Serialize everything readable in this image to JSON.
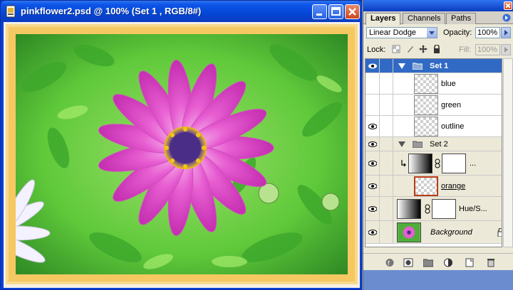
{
  "document": {
    "title": "pinkflower2.psd @ 100% (Set 1 , RGB/8#)",
    "icons": {
      "app": "photoshop-doc-icon",
      "minimize": "minimize-icon",
      "maximize": "maximize-icon",
      "close": "close-icon"
    }
  },
  "colors": {
    "frame_outer": "#f5c861",
    "frame_inner": "#f9d98b",
    "selection": "#316ac5",
    "title_blue": "#0446d6"
  },
  "layers_panel": {
    "tabs": [
      "Layers",
      "Channels",
      "Paths"
    ],
    "active_tab": "Layers",
    "blend_mode": "Linear Dodge",
    "opacity_label": "Opacity:",
    "opacity_value": "100%",
    "lock_label": "Lock:",
    "fill_label": "Fill:",
    "fill_value": "100%",
    "layers": [
      {
        "name": "Set 1",
        "type": "group",
        "expanded": true,
        "selected": true,
        "visible": true
      },
      {
        "name": "blue",
        "type": "layer",
        "visible": false
      },
      {
        "name": "green",
        "type": "layer",
        "visible": false
      },
      {
        "name": "outline",
        "type": "layer",
        "visible": true
      },
      {
        "name": "Set 2",
        "type": "group",
        "expanded": true,
        "visible": true
      },
      {
        "name": "...",
        "type": "adjustment-clipped",
        "visible": true
      },
      {
        "name": "orange",
        "type": "layer",
        "visible": true,
        "underline": true
      },
      {
        "name": "Hue/S...",
        "type": "adjustment",
        "visible": true
      },
      {
        "name": "Background",
        "type": "background",
        "visible": true,
        "locked": true
      }
    ],
    "bottom_icons": [
      "link-layers-icon",
      "add-layer-style-icon",
      "add-mask-icon",
      "new-set-icon",
      "new-adjustment-layer-icon",
      "new-layer-icon",
      "delete-layer-icon"
    ]
  }
}
